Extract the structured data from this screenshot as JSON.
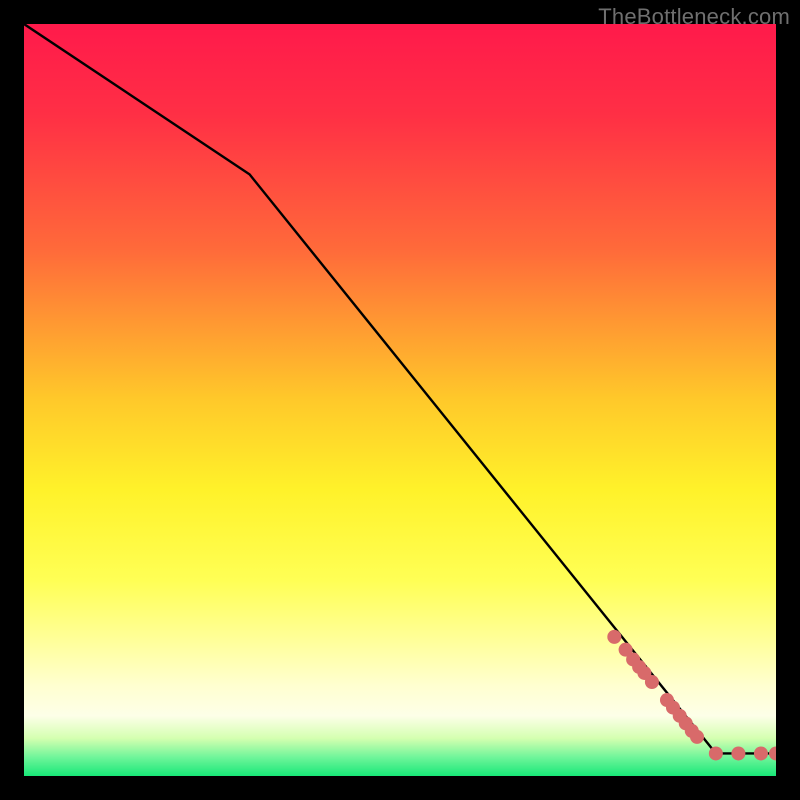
{
  "watermark": "TheBottleneck.com",
  "colors": {
    "bg": "#000000",
    "gradient_stops": [
      {
        "offset": 0.0,
        "color": "#ff1a4b"
      },
      {
        "offset": 0.12,
        "color": "#ff2f45"
      },
      {
        "offset": 0.3,
        "color": "#ff6a3a"
      },
      {
        "offset": 0.5,
        "color": "#ffc92a"
      },
      {
        "offset": 0.62,
        "color": "#fff22a"
      },
      {
        "offset": 0.74,
        "color": "#ffff55"
      },
      {
        "offset": 0.82,
        "color": "#ffff9a"
      },
      {
        "offset": 0.88,
        "color": "#ffffd0"
      },
      {
        "offset": 0.92,
        "color": "#fdffe8"
      },
      {
        "offset": 0.95,
        "color": "#d4ffb0"
      },
      {
        "offset": 0.975,
        "color": "#70f59a"
      },
      {
        "offset": 1.0,
        "color": "#18e878"
      }
    ],
    "line": "#000000",
    "marker": "#d86a6a"
  },
  "chart_data": {
    "type": "line",
    "title": "",
    "xlabel": "",
    "ylabel": "",
    "xlim": [
      0,
      100
    ],
    "ylim": [
      0,
      100
    ],
    "grid": false,
    "series": [
      {
        "name": "line",
        "x": [
          0,
          30,
          92,
          100
        ],
        "y": [
          100,
          80,
          3,
          3
        ],
        "style": "solid"
      }
    ],
    "markers": {
      "name": "points",
      "x": [
        78.5,
        80.0,
        81.0,
        81.8,
        82.5,
        83.5,
        85.5,
        86.3,
        87.2,
        88.0,
        88.8,
        89.5,
        92.0,
        95.0,
        98.0,
        100.0
      ],
      "y": [
        18.5,
        16.8,
        15.5,
        14.5,
        13.7,
        12.5,
        10.1,
        9.1,
        8.0,
        7.0,
        6.0,
        5.2,
        3.0,
        3.0,
        3.0,
        3.0
      ],
      "radius_px": 7
    }
  }
}
